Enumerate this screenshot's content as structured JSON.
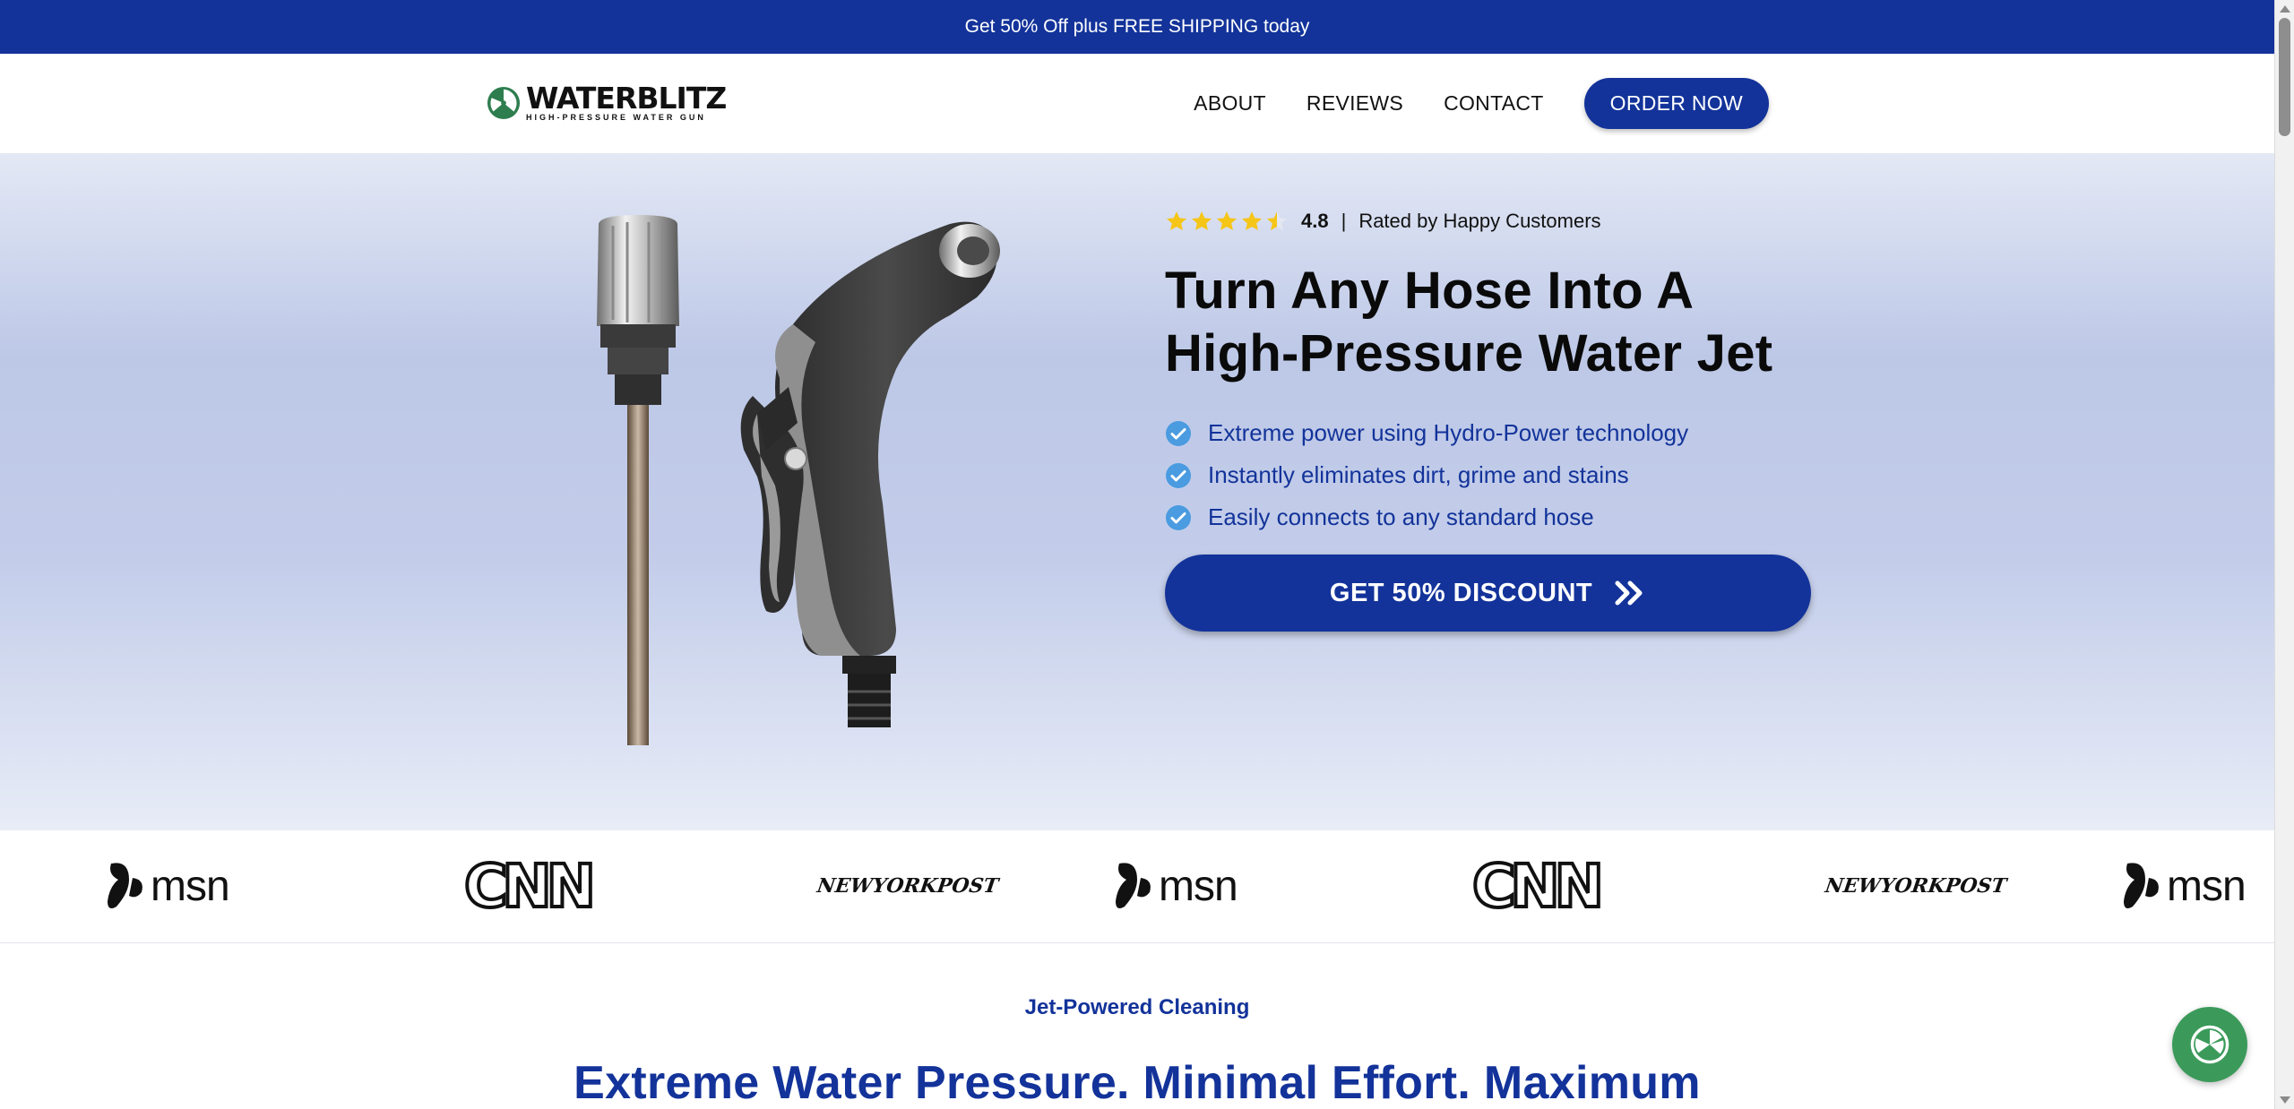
{
  "announcement": "Get 50% Off plus FREE SHIPPING today",
  "brand": {
    "name": "WATERBLITZ",
    "tagline": "HIGH-PRESSURE WATER GUN"
  },
  "nav": {
    "about": "ABOUT",
    "reviews": "REVIEWS",
    "contact": "CONTACT",
    "order": "ORDER NOW"
  },
  "hero": {
    "rating": {
      "value": 4.5,
      "score": "4.8",
      "separator": "|",
      "label": "Rated by Happy Customers"
    },
    "title_line1": "Turn Any Hose Into A",
    "title_line2": "High-Pressure Water Jet",
    "features": [
      "Extreme power using Hydro-Power technology",
      "Instantly eliminates dirt, grime and stains",
      "Easily connects to any standard hose"
    ],
    "cta": "GET 50% DISCOUNT"
  },
  "press": {
    "msn": "msn",
    "cnn": "CNN",
    "nyp": [
      "NEW",
      "YORK",
      "POST"
    ]
  },
  "section": {
    "eyebrow": "Jet-Powered Cleaning",
    "title": "Extreme Water Pressure. Minimal Effort. Maximum"
  },
  "colors": {
    "brand_blue": "#13339a",
    "check_blue": "#4a9be0",
    "star_gold": "#f5c518",
    "chat_green": "#3b9a5a"
  }
}
